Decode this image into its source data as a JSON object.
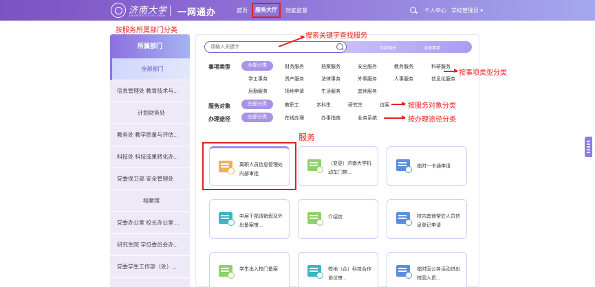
{
  "header": {
    "logo_text": "济南大学",
    "logo_sub": "UNIVERSITY OF JINAN",
    "system_title": "一网通办",
    "nav": [
      "首页",
      "服务大厅",
      "效能监督"
    ],
    "user_center": "个人中心",
    "role_select": "学校管理员 ▾"
  },
  "annotations": {
    "dept": "按服务所属部门分类",
    "keyword": "搜索关键字查找服务",
    "type": "按事项类型分类",
    "object": "按服务对象分类",
    "route": "按办理途径分类",
    "service": "服务"
  },
  "sidebar": {
    "title": "所属部门",
    "items": [
      "全部部门",
      "信息管理处 教育技术与...",
      "计划财务处",
      "教务处 教学质量与评估...",
      "科技处 科技成果转化办...",
      "党委保卫部 安全管理处",
      "档案馆",
      "党委办公室 校长办公室 ...",
      "研究生院 学位委员会办...",
      "党委学生工作部（处）..."
    ]
  },
  "search": {
    "placeholder": "请输入关键字",
    "tab_related": "与我相关",
    "tab_all": "全部事项"
  },
  "filters": {
    "type_label": "事项类型",
    "type_all": "全部分类",
    "type_row1": [
      "财务服务",
      "档案服务",
      "安全服务",
      "教务服务",
      "科研服务"
    ],
    "type_row2": [
      "学工事务",
      "资产服务",
      "法律事务",
      "外事服务",
      "人事服务",
      "信息化服务"
    ],
    "type_row3": [
      "后勤服务",
      "场地申请",
      "生活服务",
      "其他服务"
    ],
    "object_label": "服务对象",
    "object_all": "全部分类",
    "object_opts": [
      "教职工",
      "本科生",
      "研究生",
      "访客"
    ],
    "route_label": "办理途径",
    "route_all": "全部分类",
    "route_opts": [
      "在线办理",
      "办事指南",
      "业务系统"
    ]
  },
  "services": [
    {
      "title": "离职人员信息管理处内部审批",
      "icon": "document-person-icon",
      "color": "#f1b24a"
    },
    {
      "title": "（变更）济南大学机动车门禁...",
      "icon": "car-gate-icon",
      "color": "#8ed26a"
    },
    {
      "title": "临时一卡通申请",
      "icon": "id-card-icon",
      "color": "#5a8fe0"
    },
    {
      "title": "中层干部请销假及外出备案审...",
      "icon": "leave-form-icon",
      "color": "#39b6c8"
    },
    {
      "title": "介绍信",
      "icon": "letter-icon",
      "color": "#8ed26a"
    },
    {
      "title": "校内其他常驻人员信息登记申请",
      "icon": "register-icon",
      "color": "#5a8fe0"
    },
    {
      "title": "学生出入校门备案",
      "icon": "student-gate-icon",
      "color": "#8ed26a"
    },
    {
      "title": "校地（企）科技合作协议审...",
      "icon": "agreement-icon",
      "color": "#39b6c8"
    },
    {
      "title": "临时因公务活动进出校园人员...",
      "icon": "visitor-icon",
      "color": "#5a8fe0"
    }
  ]
}
